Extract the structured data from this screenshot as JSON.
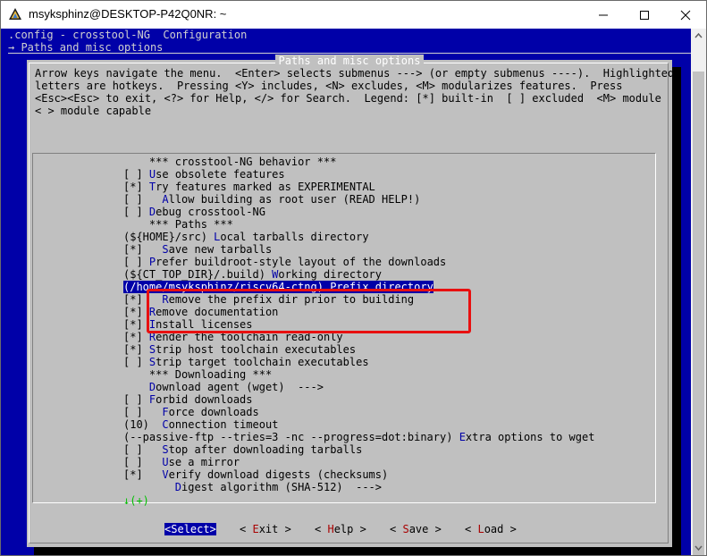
{
  "window": {
    "title": "msyksphinz@DESKTOP-P42Q0NR: ~"
  },
  "terminal": {
    "header_config": ".config - crosstool-NG  Configuration",
    "header_path": "→ Paths and misc options"
  },
  "dialog": {
    "title": "Paths and misc options",
    "help_lines": [
      "Arrow keys navigate the menu.  <Enter> selects submenus ---> (or empty submenus ----).  Highlighted",
      "letters are hotkeys.  Pressing <Y> includes, <N> excludes, <M> modularizes features.  Press",
      "<Esc><Esc> to exit, <?> for Help, </> for Search.  Legend: [*] built-in  [ ] excluded  <M> module",
      "< > module capable"
    ],
    "more_indicator": "↓(+)"
  },
  "menu": {
    "items": [
      {
        "pre": "    *** crosstool-NG behavior ***",
        "hk": "",
        "post": ""
      },
      {
        "pre": "[ ] ",
        "hk": "U",
        "post": "se obsolete features"
      },
      {
        "pre": "[*] ",
        "hk": "T",
        "post": "ry features marked as EXPERIMENTAL"
      },
      {
        "pre": "[ ]   ",
        "hk": "A",
        "post": "llow building as root user (READ HELP!)"
      },
      {
        "pre": "[ ] ",
        "hk": "D",
        "post": "ebug crosstool-NG"
      },
      {
        "pre": "    *** Paths ***",
        "hk": "",
        "post": ""
      },
      {
        "pre": "(${HOME}/src) ",
        "hk": "L",
        "post": "ocal tarballs directory"
      },
      {
        "pre": "[*]   ",
        "hk": "S",
        "post": "ave new tarballs"
      },
      {
        "pre": "[ ] ",
        "hk": "P",
        "post": "refer buildroot-style layout of the downloads"
      },
      {
        "pre": "(${CT_TOP_DIR}/.build) ",
        "hk": "W",
        "post": "orking directory"
      },
      {
        "pre": "(/home/msyksphinz/riscv64-ctng) ",
        "hk": "P",
        "post": "refix directory"
      },
      {
        "pre": "[*]   ",
        "hk": "R",
        "post": "emove the prefix dir prior to building"
      },
      {
        "pre": "[*] ",
        "hk": "R",
        "post": "emove documentation"
      },
      {
        "pre": "[*] ",
        "hk": "I",
        "post": "nstall licenses"
      },
      {
        "pre": "[*] ",
        "hk": "R",
        "post": "ender the toolchain read-only"
      },
      {
        "pre": "[*] ",
        "hk": "S",
        "post": "trip host toolchain executables"
      },
      {
        "pre": "[ ] ",
        "hk": "S",
        "post": "trip target toolchain executables"
      },
      {
        "pre": "    *** Downloading ***",
        "hk": "",
        "post": ""
      },
      {
        "pre": "    ",
        "hk": "D",
        "post": "ownload agent (wget)  --->"
      },
      {
        "pre": "[ ] ",
        "hk": "F",
        "post": "orbid downloads"
      },
      {
        "pre": "[ ]   ",
        "hk": "F",
        "post": "orce downloads"
      },
      {
        "pre": "(10)  ",
        "hk": "C",
        "post": "onnection timeout"
      },
      {
        "pre": "(--passive-ftp --tries=3 -nc --progress=dot:binary) ",
        "hk": "E",
        "post": "xtra options to wget"
      },
      {
        "pre": "[ ]   ",
        "hk": "S",
        "post": "top after downloading tarballs"
      },
      {
        "pre": "[ ]   ",
        "hk": "U",
        "post": "se a mirror"
      },
      {
        "pre": "[*]   ",
        "hk": "V",
        "post": "erify download digests (checksums)"
      },
      {
        "pre": "        ",
        "hk": "D",
        "post": "igest algorithm (SHA-512)  --->"
      }
    ]
  },
  "buttons": {
    "select": {
      "pre": "<",
      "hk": "S",
      "post": "elect>"
    },
    "exit": {
      "pre": "< ",
      "hk": "E",
      "post": "xit >"
    },
    "help": {
      "pre": "< ",
      "hk": "H",
      "post": "elp >"
    },
    "save": {
      "pre": "< ",
      "hk": "S",
      "post": "ave >"
    },
    "load": {
      "pre": "< ",
      "hk": "L",
      "post": "oad >"
    }
  }
}
